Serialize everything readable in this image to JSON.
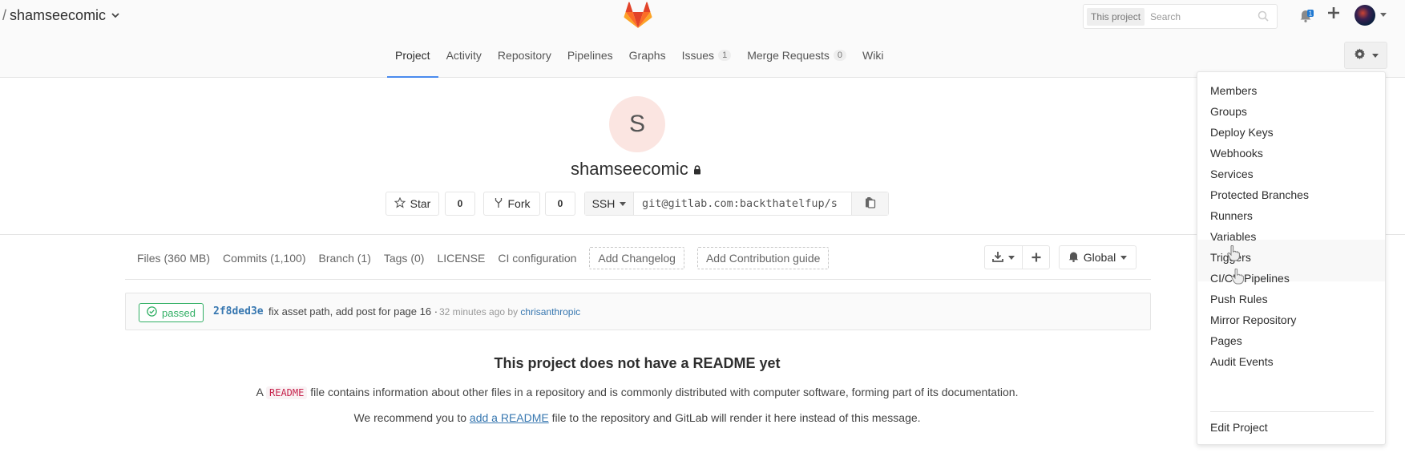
{
  "header": {
    "namespace_sep": "/",
    "project_path": "shamseecomic",
    "search_scope": "This project",
    "search_placeholder": "Search",
    "notification_count": "1"
  },
  "tabs": [
    {
      "label": "Project",
      "active": true
    },
    {
      "label": "Activity"
    },
    {
      "label": "Repository"
    },
    {
      "label": "Pipelines"
    },
    {
      "label": "Graphs"
    },
    {
      "label": "Issues",
      "badge": "1"
    },
    {
      "label": "Merge Requests",
      "badge": "0"
    },
    {
      "label": "Wiki"
    }
  ],
  "project": {
    "avatar_letter": "S",
    "name": "shamseecomic",
    "star_label": "Star",
    "star_count": "0",
    "fork_label": "Fork",
    "fork_count": "0",
    "clone_protocol": "SSH",
    "clone_url": "git@gitlab.com:backthatelfup/s"
  },
  "stats": {
    "files": "Files (360 MB)",
    "commits": "Commits (1,100)",
    "branch": "Branch (1)",
    "tags": "Tags (0)",
    "license": "LICENSE",
    "ci": "CI configuration",
    "add_changelog": "Add Changelog",
    "add_contrib": "Add Contribution guide",
    "notification_level": "Global"
  },
  "commit": {
    "status": "passed",
    "sha": "2f8ded3e",
    "message": "fix asset path, add post for page 16 ·",
    "meta": "32 minutes ago by",
    "author": "chrisanthropic"
  },
  "readme": {
    "title": "This project does not have a README yet",
    "line1_pre": "A",
    "line1_code": "README",
    "line1_post": "file contains information about other files in a repository and is commonly distributed with computer software, forming part of its documentation.",
    "line2_pre": "We recommend you to",
    "line2_link": "add a README",
    "line2_post": "file to the repository and GitLab will render it here instead of this message."
  },
  "settings_menu": {
    "items": [
      "Members",
      "Groups",
      "Deploy Keys",
      "Webhooks",
      "Services",
      "Protected Branches",
      "Runners",
      "Variables",
      "Triggers",
      "CI/CD Pipelines",
      "Push Rules",
      "Mirror Repository",
      "Pages",
      "Audit Events"
    ],
    "edit_project": "Edit Project"
  },
  "colors": {
    "accent": "#4a8bee",
    "link": "#3777b0",
    "success": "#31af64",
    "logo_orange": "#fc6d26"
  }
}
